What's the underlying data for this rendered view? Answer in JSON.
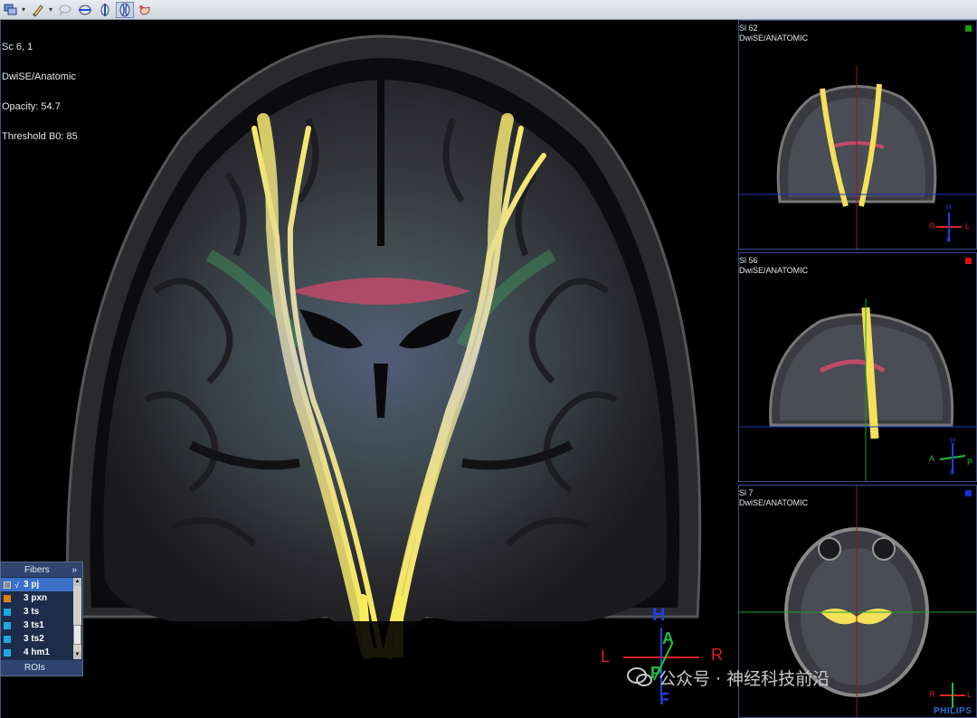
{
  "colors": {
    "fiber": "#f4e05a",
    "panel_bg": "#1d2c4a",
    "selected_row": "#3b6fc8",
    "axis_red": "#e02020",
    "axis_blue": "#2040e0",
    "axis_green": "#20c040"
  },
  "toolbar": {
    "icons": [
      "layers-icon",
      "edit-brush-icon",
      "lasso-icon",
      "horizontal-plane-icon",
      "vertical-plane-icon",
      "fiber-track-icon",
      "hand-tool-icon"
    ]
  },
  "main_view": {
    "overlay": {
      "line1": "Sc 6, 1",
      "line2": "DwiSE/Anatomic",
      "line3": "Opacity: 54.7",
      "line4": "Threshold B0: 85"
    },
    "orientation": {
      "head": "H",
      "anterior": "A",
      "left": "L",
      "right": "R",
      "posterior": "P",
      "foot": "F"
    }
  },
  "side_views": [
    {
      "title": "Sl 62",
      "subtitle": "DwiSE/ANATOMIC",
      "marker_color": "#10a010",
      "orient": {
        "top": "H",
        "left": "R",
        "right": "L",
        "bottom": "F"
      }
    },
    {
      "title": "Sl 56",
      "subtitle": "DwiSE/ANATOMIC",
      "marker_color": "#e01010",
      "orient": {
        "top": "H",
        "left": "A",
        "right": "P",
        "bottom": "F"
      }
    },
    {
      "title": "Sl 7",
      "subtitle": "DwiSE/ANATOMIC",
      "marker_color": "#1030e0",
      "orient": {
        "top": "",
        "left": "R",
        "right": "L",
        "bottom": ""
      }
    }
  ],
  "fibers_panel": {
    "title": "Fibers",
    "expand": "»",
    "items": [
      {
        "label": "3 pj",
        "checked": true,
        "selected": true,
        "color": "#8a8a8a"
      },
      {
        "label": "3 pxn",
        "checked": false,
        "selected": false,
        "color": "#e08010"
      },
      {
        "label": "3 ts",
        "checked": false,
        "selected": false,
        "color": "#20a8e0"
      },
      {
        "label": "3 ts1",
        "checked": false,
        "selected": false,
        "color": "#20a8e0"
      },
      {
        "label": "3 ts2",
        "checked": false,
        "selected": false,
        "color": "#20a8e0"
      },
      {
        "label": "4 hm1",
        "checked": false,
        "selected": false,
        "color": "#20a8e0"
      }
    ],
    "check_mark": "√",
    "footer": "ROIs"
  },
  "watermark": "公众号 · 神经科技前沿",
  "brand": "PHILIPS"
}
